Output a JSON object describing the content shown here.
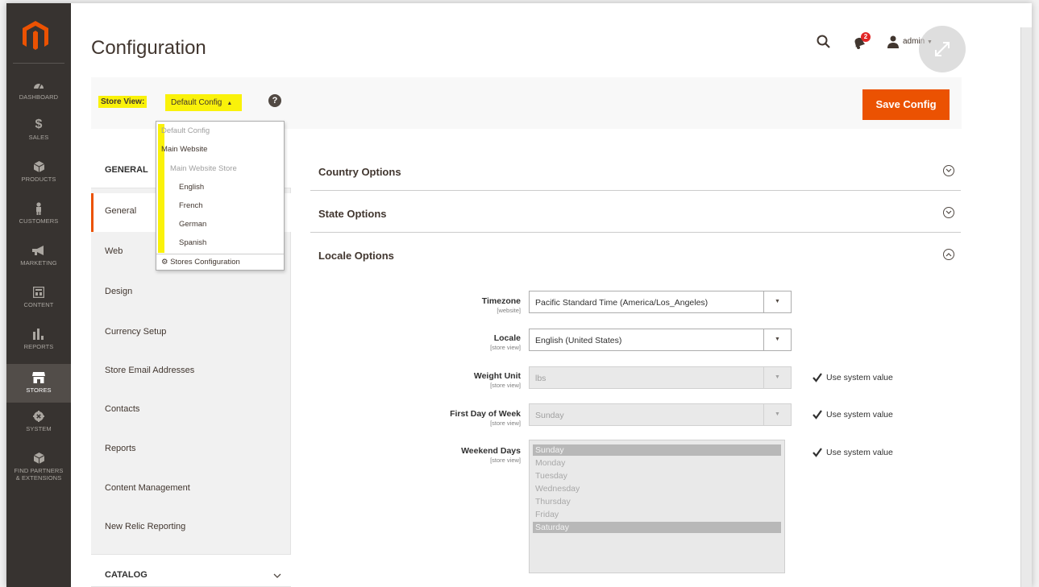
{
  "app": {
    "page_title": "Configuration"
  },
  "header": {
    "user": "admin",
    "notifications_count": "2"
  },
  "sidebar": {
    "items": [
      {
        "label": "DASHBOARD",
        "icon": "dashboard-icon"
      },
      {
        "label": "SALES",
        "icon": "dollar-icon"
      },
      {
        "label": "PRODUCTS",
        "icon": "cube-icon"
      },
      {
        "label": "CUSTOMERS",
        "icon": "person-icon"
      },
      {
        "label": "MARKETING",
        "icon": "megaphone-icon"
      },
      {
        "label": "CONTENT",
        "icon": "layout-icon"
      },
      {
        "label": "REPORTS",
        "icon": "bar-chart-icon"
      },
      {
        "label": "STORES",
        "icon": "store-icon"
      },
      {
        "label": "SYSTEM",
        "icon": "gear-icon"
      },
      {
        "label": "FIND PARTNERS & EXTENSIONS",
        "label_line1": "FIND PARTNERS",
        "label_line2": "& EXTENSIONS",
        "icon": "cube-icon"
      }
    ],
    "active": "STORES"
  },
  "toolbar": {
    "store_view_label": "Store View:",
    "store_view_value": "Default Config",
    "save_label": "Save Config"
  },
  "scope_dropdown": {
    "items": [
      {
        "label": "Default Config",
        "disabled": true
      },
      {
        "label": "Main Website",
        "disabled": false
      },
      {
        "label": "Main Website Store",
        "disabled": true
      },
      {
        "label": "English",
        "disabled": false
      },
      {
        "label": "French",
        "disabled": false
      },
      {
        "label": "German",
        "disabled": false
      },
      {
        "label": "Spanish",
        "disabled": false
      }
    ],
    "footer": "Stores Configuration"
  },
  "config_nav": {
    "group_general": "GENERAL",
    "items": [
      "General",
      "Web",
      "Design",
      "Currency Setup",
      "Store Email Addresses",
      "Contacts",
      "Reports",
      "Content Management",
      "New Relic Reporting"
    ],
    "active": "General",
    "group_catalog": "CATALOG"
  },
  "sections": {
    "country": "Country Options",
    "state": "State Options",
    "locale": "Locale Options"
  },
  "locale_fields": {
    "timezone": {
      "label": "Timezone",
      "scope": "[website]",
      "value": "Pacific Standard Time (America/Los_Angeles)"
    },
    "locale": {
      "label": "Locale",
      "scope": "[store view]",
      "value": "English (United States)"
    },
    "weight_unit": {
      "label": "Weight Unit",
      "scope": "[store view]",
      "value": "lbs",
      "use_system": "Use system value"
    },
    "first_day": {
      "label": "First Day of Week",
      "scope": "[store view]",
      "value": "Sunday",
      "use_system": "Use system value"
    },
    "weekend_days": {
      "label": "Weekend Days",
      "scope": "[store view]",
      "use_system": "Use system value",
      "options": [
        "Sunday",
        "Monday",
        "Tuesday",
        "Wednesday",
        "Thursday",
        "Friday",
        "Saturday"
      ],
      "selected": [
        "Sunday",
        "Saturday"
      ]
    }
  },
  "colors": {
    "accent": "#eb5202",
    "sidebar_bg": "#373330",
    "highlight": "#faf20a"
  }
}
